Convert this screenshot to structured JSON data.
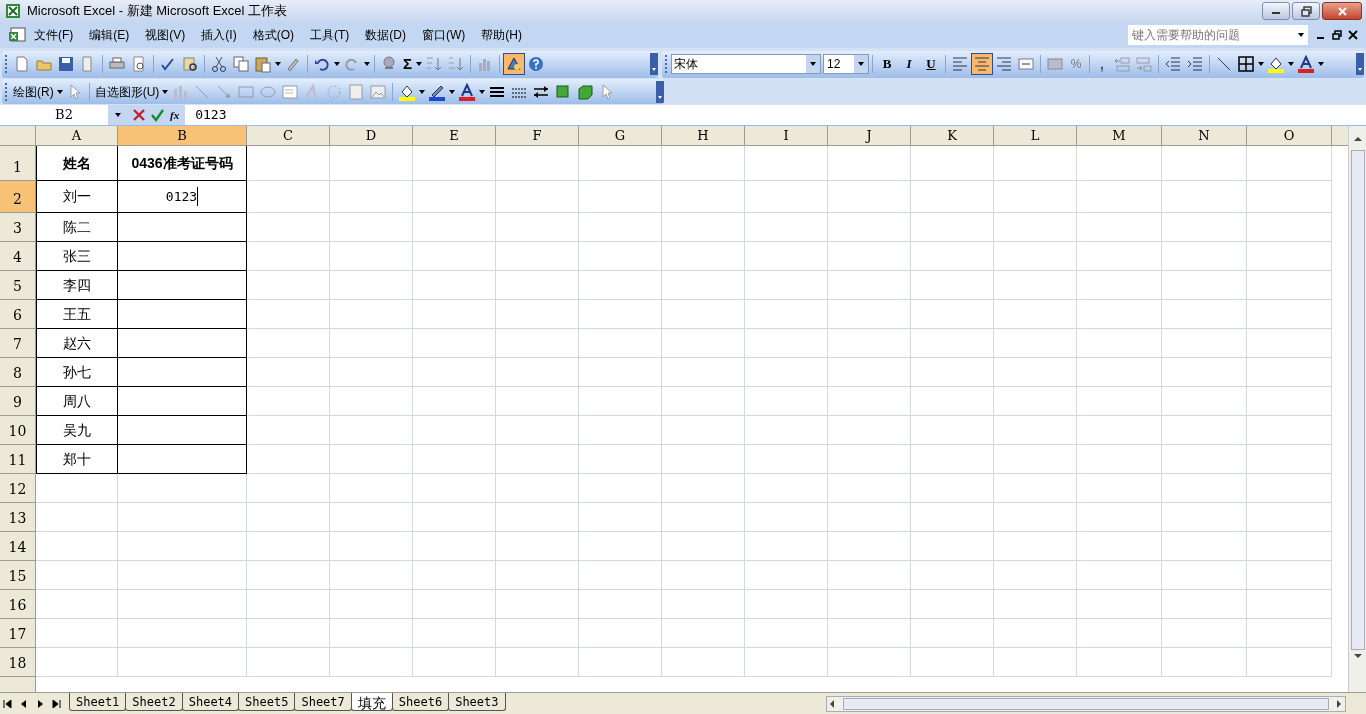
{
  "window": {
    "title": "Microsoft Excel - 新建 Microsoft Excel 工作表"
  },
  "menu": [
    {
      "label": "文件(F)"
    },
    {
      "label": "编辑(E)"
    },
    {
      "label": "视图(V)"
    },
    {
      "label": "插入(I)"
    },
    {
      "label": "格式(O)"
    },
    {
      "label": "工具(T)"
    },
    {
      "label": "数据(D)"
    },
    {
      "label": "窗口(W)"
    },
    {
      "label": "帮助(H)"
    }
  ],
  "help_box": {
    "placeholder": "键入需要帮助的问题"
  },
  "standard_toolbar": {
    "sum_label": "Σ",
    "drawing_toggle": {
      "selected": true
    }
  },
  "formatting_toolbar": {
    "font": "宋体",
    "size": "12",
    "styles": [
      {
        "label": "B",
        "kind": "bold"
      },
      {
        "label": "I",
        "kind": "italic"
      },
      {
        "label": "U",
        "kind": "underline"
      }
    ],
    "alignments": [
      {
        "selected": false
      },
      {
        "selected": true
      },
      {
        "selected": false
      },
      {
        "selected": false
      }
    ],
    "percent": "%",
    "comma": ","
  },
  "drawing_toolbar": {
    "draw_menu": "绘图(R)",
    "autoshapes_menu": "自选图形(U)"
  },
  "formula_bar": {
    "name_box": "B2",
    "function_label": "fx",
    "formula": "0123"
  },
  "columns": [
    {
      "label": "A",
      "selected": false
    },
    {
      "label": "B",
      "selected": true
    },
    {
      "label": "C",
      "selected": false
    },
    {
      "label": "D",
      "selected": false
    },
    {
      "label": "E",
      "selected": false
    },
    {
      "label": "F",
      "selected": false
    },
    {
      "label": "G",
      "selected": false
    },
    {
      "label": "H",
      "selected": false
    },
    {
      "label": "I",
      "selected": false
    },
    {
      "label": "J",
      "selected": false
    },
    {
      "label": "K",
      "selected": false
    },
    {
      "label": "L",
      "selected": false
    },
    {
      "label": "M",
      "selected": false
    },
    {
      "label": "N",
      "selected": false
    },
    {
      "label": "O",
      "selected": false
    }
  ],
  "rows": [
    {
      "label": "1",
      "selected": false,
      "bold": true,
      "cells": [
        "姓名",
        "0436准考证号码"
      ]
    },
    {
      "label": "2",
      "selected": true,
      "cells": [
        "刘一",
        "0123"
      ],
      "editing": true
    },
    {
      "label": "3",
      "selected": false,
      "cells": [
        "陈二"
      ]
    },
    {
      "label": "4",
      "selected": false,
      "cells": [
        "张三"
      ]
    },
    {
      "label": "5",
      "selected": false,
      "cells": [
        "李四"
      ]
    },
    {
      "label": "6",
      "selected": false,
      "cells": [
        "王五"
      ]
    },
    {
      "label": "7",
      "selected": false,
      "cells": [
        "赵六"
      ]
    },
    {
      "label": "8",
      "selected": false,
      "cells": [
        "孙七"
      ]
    },
    {
      "label": "9",
      "selected": false,
      "cells": [
        "周八"
      ]
    },
    {
      "label": "10",
      "selected": false,
      "cells": [
        "吴九"
      ]
    },
    {
      "label": "11",
      "selected": false,
      "cells": [
        "郑十"
      ]
    },
    {
      "label": "12",
      "selected": false
    },
    {
      "label": "13",
      "selected": false
    },
    {
      "label": "14",
      "selected": false
    },
    {
      "label": "15",
      "selected": false
    },
    {
      "label": "16",
      "selected": false
    },
    {
      "label": "17",
      "selected": false
    },
    {
      "label": "18",
      "selected": false
    }
  ],
  "sheet_tabs": [
    {
      "label": "Sheet1",
      "selected": false
    },
    {
      "label": "Sheet2",
      "selected": false
    },
    {
      "label": "Sheet4",
      "selected": false
    },
    {
      "label": "Sheet5",
      "selected": false
    },
    {
      "label": "Sheet7",
      "selected": false
    },
    {
      "label": "填充",
      "selected": true
    },
    {
      "label": "Sheet6",
      "selected": false
    },
    {
      "label": "Sheet3",
      "selected": false
    }
  ]
}
